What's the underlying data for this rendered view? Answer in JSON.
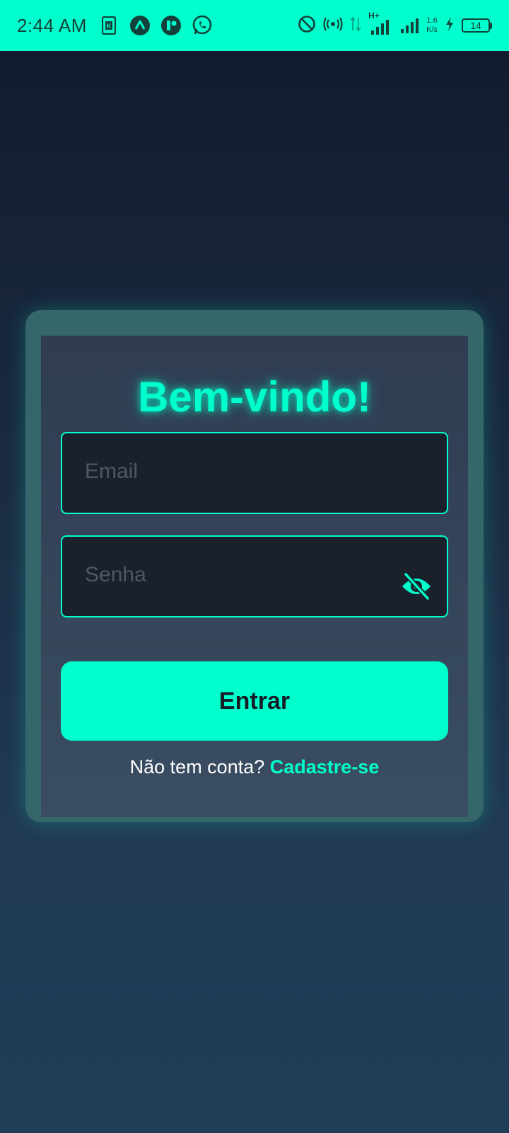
{
  "status_bar": {
    "time": "2:44 AM",
    "network_type": "H+",
    "net_speed_value": "1.6",
    "net_speed_unit": "K/s",
    "battery_level": "14",
    "left_icons": [
      "k-app-icon",
      "arrow-up-app-icon",
      "r-app-icon",
      "whatsapp-icon"
    ],
    "right_icons": [
      "do-not-disturb-icon",
      "hotspot-icon",
      "data-arrows-icon",
      "signal-icon",
      "signal-icon",
      "charging-icon",
      "battery-icon"
    ]
  },
  "login": {
    "title": "Bem-vindo!",
    "email_placeholder": "Email",
    "email_value": "",
    "password_placeholder": "Senha",
    "password_value": "",
    "password_toggle_icon": "eye-off-icon",
    "submit_label": "Entrar",
    "signup_prompt": "Não tem conta?",
    "signup_link": "Cadastre-se"
  },
  "colors": {
    "accent": "#00ffcc",
    "background_top": "#111a2c",
    "background_bottom": "#213e57",
    "card_border": "#35666a",
    "input_bg": "#1b212c",
    "button_text": "#161d27"
  }
}
